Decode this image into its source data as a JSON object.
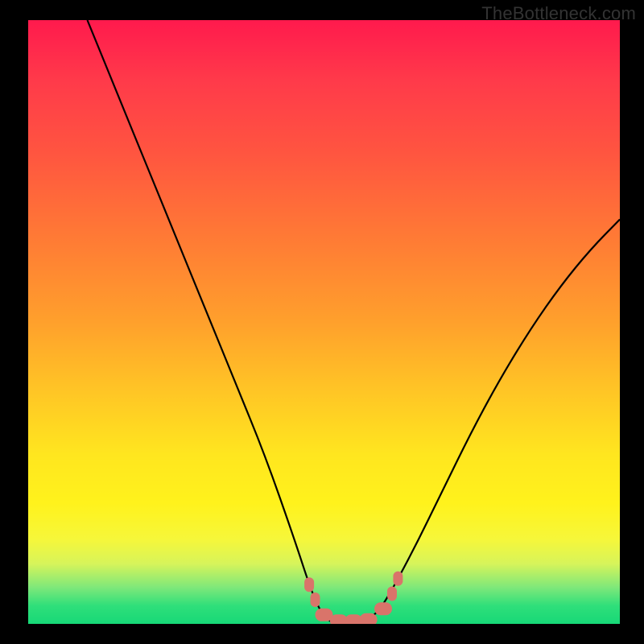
{
  "watermark": "TheBottleneck.com",
  "colors": {
    "curve_stroke": "#000000",
    "marker_fill": "#d9746a",
    "marker_stroke": "#b85a52",
    "background": "#000000",
    "gradient_top": "#ff1a4d",
    "gradient_bottom": "#17d877"
  },
  "chart_data": {
    "type": "line",
    "title": "",
    "xlabel": "",
    "ylabel": "",
    "xlim": [
      0,
      100
    ],
    "ylim": [
      0,
      100
    ],
    "grid": false,
    "legend": "none",
    "annotations": [
      "TheBottleneck.com"
    ],
    "series": [
      {
        "name": "bottleneck-curve",
        "x": [
          10,
          15,
          20,
          25,
          30,
          35,
          40,
          45,
          48,
          50,
          52,
          55,
          58,
          60,
          65,
          70,
          75,
          80,
          85,
          90,
          95,
          100
        ],
        "y": [
          100,
          88,
          76,
          64,
          52,
          40,
          28,
          14,
          5,
          1,
          0,
          0,
          1,
          3,
          12,
          22,
          32,
          41,
          49,
          56,
          62,
          67
        ]
      }
    ],
    "markers": [
      {
        "x": 47.5,
        "y": 6.5,
        "size": "small"
      },
      {
        "x": 48.5,
        "y": 4.0,
        "size": "small"
      },
      {
        "x": 50.0,
        "y": 1.5,
        "size": "medium"
      },
      {
        "x": 52.5,
        "y": 0.5,
        "size": "medium"
      },
      {
        "x": 55.0,
        "y": 0.5,
        "size": "medium"
      },
      {
        "x": 57.5,
        "y": 0.7,
        "size": "medium"
      },
      {
        "x": 60.0,
        "y": 2.5,
        "size": "medium"
      },
      {
        "x": 61.5,
        "y": 5.0,
        "size": "small"
      },
      {
        "x": 62.5,
        "y": 7.5,
        "size": "small"
      }
    ]
  }
}
